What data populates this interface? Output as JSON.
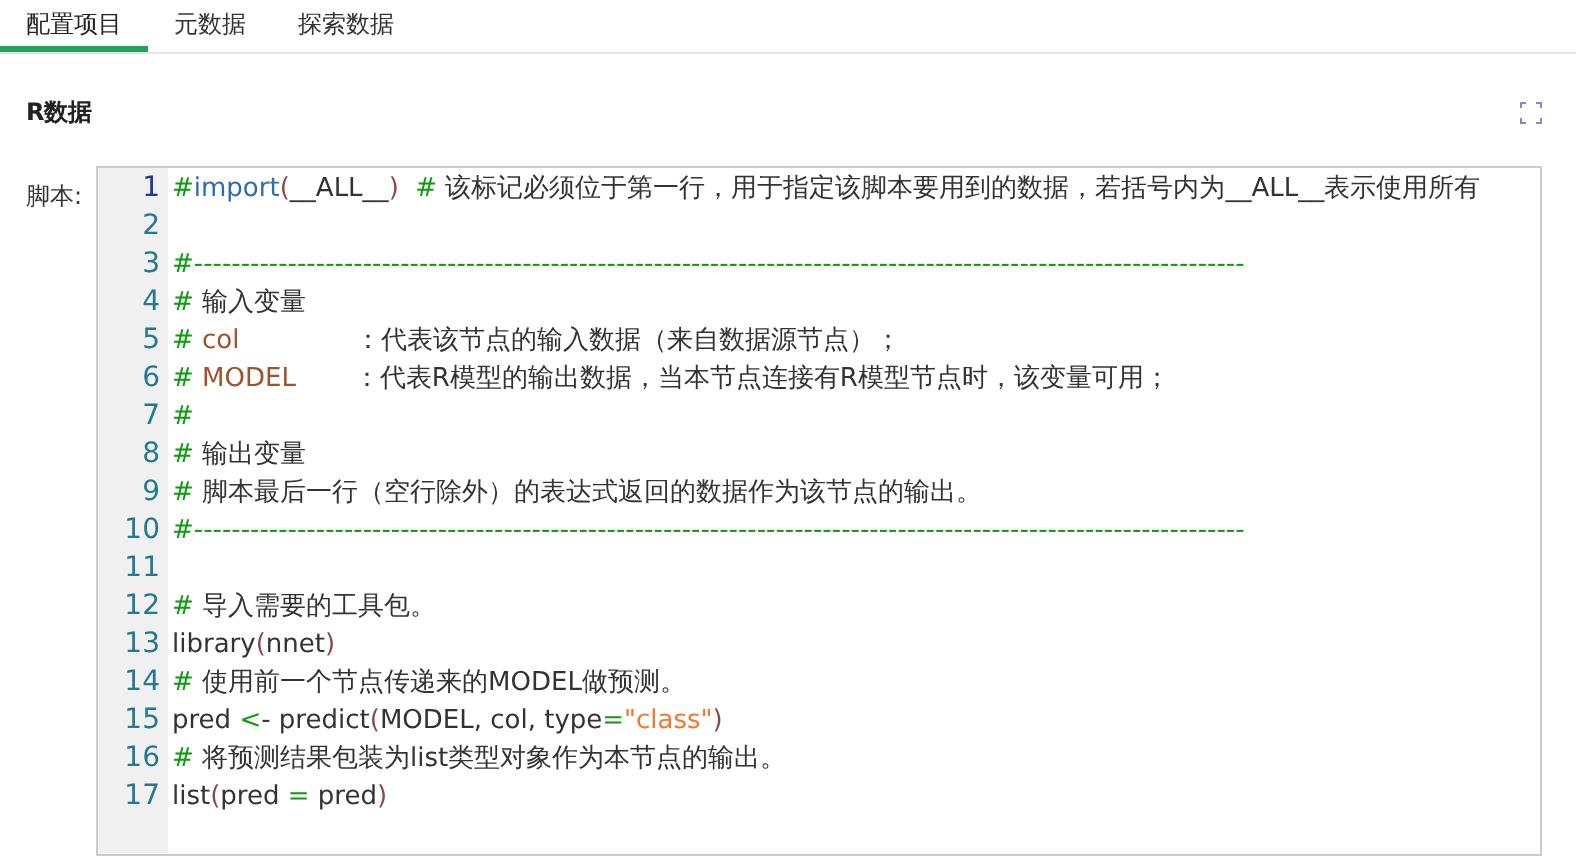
{
  "tabs": [
    {
      "label": "配置项目",
      "selected": true
    },
    {
      "label": "元数据",
      "selected": false
    },
    {
      "label": "探索数据",
      "selected": false
    }
  ],
  "section_title": "R数据",
  "script_label": "脚本:",
  "editor": {
    "lines": [
      {
        "number": "1",
        "active": true,
        "tokens": [
          {
            "text": "#",
            "kind": "comment"
          },
          {
            "text": "import",
            "kind": "keyword"
          },
          {
            "text": "(",
            "kind": "paren"
          },
          {
            "text": "__ALL__",
            "kind": "text"
          },
          {
            "text": ")",
            "kind": "paren"
          },
          {
            "text": "  #",
            "kind": "comment"
          },
          {
            "text": " 该标记必须位于第一行，用于指定该脚本要用到的数据，若括号内为__ALL__表示使用所有",
            "kind": "text"
          }
        ]
      },
      {
        "number": "2",
        "active": false
      },
      {
        "number": "3",
        "active": false,
        "tokens": [
          {
            "text": "#----------------------------------------------------------------------------------------------------------------",
            "kind": "comment"
          }
        ]
      },
      {
        "number": "4",
        "active": false,
        "tokens": [
          {
            "text": "#",
            "kind": "comment"
          },
          {
            "text": " 输入变量",
            "kind": "text"
          }
        ]
      },
      {
        "number": "5",
        "active": false,
        "tokens": [
          {
            "text": "#",
            "kind": "comment"
          },
          {
            "text": " col",
            "kind": "variable"
          },
          {
            "text": "              ：代表该节点的输入数据（来自数据源节点）；",
            "kind": "text"
          }
        ]
      },
      {
        "number": "6",
        "active": false,
        "tokens": [
          {
            "text": "#",
            "kind": "comment"
          },
          {
            "text": " MODEL",
            "kind": "variable"
          },
          {
            "text": "       ：代表R模型的输出数据，当本节点连接有R模型节点时，该变量可用；",
            "kind": "text"
          }
        ]
      },
      {
        "number": "7",
        "active": false,
        "tokens": [
          {
            "text": "#",
            "kind": "comment"
          }
        ]
      },
      {
        "number": "8",
        "active": false,
        "tokens": [
          {
            "text": "#",
            "kind": "comment"
          },
          {
            "text": " 输出变量",
            "kind": "text"
          }
        ]
      },
      {
        "number": "9",
        "active": false,
        "tokens": [
          {
            "text": "#",
            "kind": "comment"
          },
          {
            "text": " 脚本最后一行（空行除外）的表达式返回的数据作为该节点的输出。",
            "kind": "text"
          }
        ]
      },
      {
        "number": "10",
        "active": false,
        "tokens": [
          {
            "text": "#----------------------------------------------------------------------------------------------------------------",
            "kind": "comment"
          }
        ]
      },
      {
        "number": "11",
        "active": false
      },
      {
        "number": "12",
        "active": false,
        "tokens": [
          {
            "text": "#",
            "kind": "comment"
          },
          {
            "text": " 导入需要的工具包。",
            "kind": "text"
          }
        ]
      },
      {
        "number": "13",
        "active": false,
        "tokens": [
          {
            "text": "library",
            "kind": "text"
          },
          {
            "text": "(",
            "kind": "paren"
          },
          {
            "text": "nnet",
            "kind": "text"
          },
          {
            "text": ")",
            "kind": "paren"
          }
        ]
      },
      {
        "number": "14",
        "active": false,
        "tokens": [
          {
            "text": "#",
            "kind": "comment"
          },
          {
            "text": " 使用前一个节点传递来的MODEL做预测。",
            "kind": "text"
          }
        ]
      },
      {
        "number": "15",
        "active": false,
        "tokens": [
          {
            "text": "pred ",
            "kind": "text"
          },
          {
            "text": "<",
            "kind": "operator"
          },
          {
            "text": "- predict",
            "kind": "text"
          },
          {
            "text": "(",
            "kind": "paren"
          },
          {
            "text": "MODEL, col, type",
            "kind": "text"
          },
          {
            "text": "=",
            "kind": "operator"
          },
          {
            "text": "\"class\"",
            "kind": "string"
          },
          {
            "text": ")",
            "kind": "paren"
          }
        ]
      },
      {
        "number": "16",
        "active": false,
        "tokens": [
          {
            "text": "#",
            "kind": "comment"
          },
          {
            "text": " 将预测结果包装为list类型对象作为本节点的输出。",
            "kind": "text"
          }
        ]
      },
      {
        "number": "17",
        "active": false,
        "tokens": [
          {
            "text": "list",
            "kind": "text"
          },
          {
            "text": "(",
            "kind": "paren"
          },
          {
            "text": "pred ",
            "kind": "text"
          },
          {
            "text": "=",
            "kind": "operator"
          },
          {
            "text": " pred",
            "kind": "text"
          },
          {
            "text": ")",
            "kind": "paren"
          }
        ]
      }
    ]
  }
}
